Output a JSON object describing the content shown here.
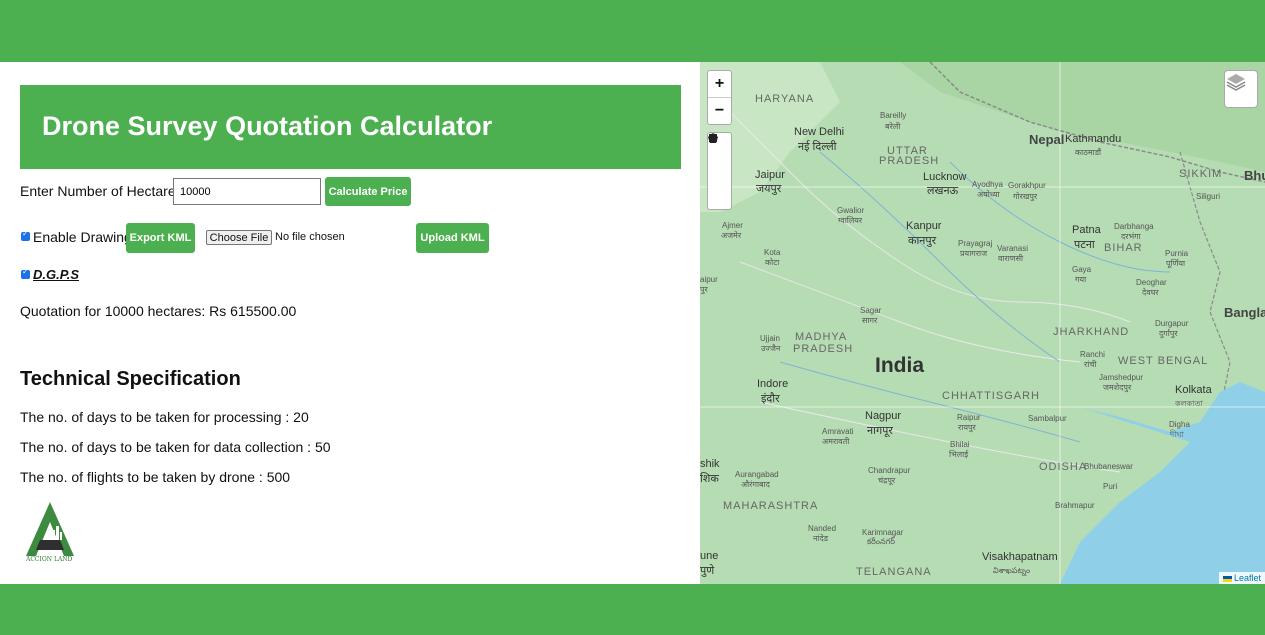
{
  "header": {
    "title": "Drone Survey Quotation Calculator"
  },
  "form": {
    "hectares_label": "Enter Number of Hectares:",
    "hectares_value": "10000",
    "calculate_label": "Calculate Price",
    "enable_drawing_label": "Enable Drawing",
    "export_kml_label": "Export KML",
    "choose_file_label": "Choose File",
    "file_status": "No file chosen",
    "upload_kml_label": "Upload KML",
    "dgps_label": "D.G.P.S"
  },
  "quotation": {
    "text": "Quotation for 10000 hectares: Rs 615500.00"
  },
  "tech": {
    "title": "Technical Specification",
    "processing": "The no. of days to be taken for processing : 20",
    "collection": "The no. of days to be taken for data collection : 50",
    "flights": "The no. of flights to be taken by drone : 500"
  },
  "logo": {
    "text": "ACCION LAND"
  },
  "map": {
    "zoom_in": "+",
    "zoom_out": "−",
    "attribution": "Leaflet",
    "labels": {
      "haryana": "HARYANA",
      "new_delhi": "New Delhi",
      "new_delhi_hi": "नई दिल्ली",
      "bareilly": "Bareilly",
      "bareilly_hi": "बरेली",
      "uttar": "UTTAR",
      "pradesh_up": "PRADESH",
      "nepal": "Nepal",
      "kathmandu": "Kathmandu",
      "kathmandu_ne": "काठमाडौं",
      "sikkim": "SIKKIM",
      "bhu": "Bhu",
      "siliguri": "Siliguri",
      "jaipur": "Jaipur",
      "jaipur_hi": "जयपुर",
      "lucknow": "Lucknow",
      "lucknow_hi": "लखनऊ",
      "ayodhya": "Ayodhya",
      "ayodhya_hi": "अयोध्या",
      "gorakhpur": "Gorakhpur",
      "gorakhpur_hi": "गोरखपुर",
      "gwalior": "Gwalior",
      "gwalior_hi": "ग्वालियर",
      "kanpur": "Kanpur",
      "kanpur_hi": "कानपुर",
      "patna": "Patna",
      "patna_hi": "पटना",
      "darbhanga": "Darbhanga",
      "darbhanga_hi": "दरभंगा",
      "ajmer": "Ajmer",
      "ajmer_hi": "अजमेर",
      "prayagraj": "Prayagraj",
      "prayagraj_hi": "प्रयागराज",
      "varanasi": "Varanasi",
      "varanasi_hi": "वाराणसी",
      "bihar": "BIHAR",
      "purnia": "Purnia",
      "purnia_hi": "पूर्णिया",
      "kota": "Kota",
      "kota_hi": "कोटा",
      "gaya": "Gaya",
      "gaya_hi": "गया",
      "deoghar": "Deoghar",
      "deoghar_hi": "देवघर",
      "udaipur": "aipur",
      "udaipur_hi": "पुर",
      "bangla": "Bangla",
      "sagar": "Sagar",
      "sagar_hi": "सागर",
      "jharkhand": "JHARKHAND",
      "durgapur": "Durgapur",
      "durgapur_hi": "दुर्गापुर",
      "ujjain": "Ujjain",
      "ujjain_hi": "उज्जैन",
      "madhya": "MADHYA",
      "pradesh_mp": "PRADESH",
      "ranchi": "Ranchi",
      "ranchi_hi": "रांची",
      "west_bengal": "WEST BENGAL",
      "india": "India",
      "jamshedpur": "Jamshedpur",
      "jamshedpur_hi": "जमशेदपुर",
      "indore": "Indore",
      "indore_hi": "इंदौर",
      "kolkata": "Kolkata",
      "kolkata_bn": "কলকাতা",
      "chhattisgarh": "CHHATTISGARH",
      "nagpur": "Nagpur",
      "nagpur_mr": "नागपूर",
      "raipur": "Raipur",
      "raipur_hi": "रायपुर",
      "sambalpur": "Sambalpur",
      "digha": "Digha",
      "digha_bn": "দীঘা",
      "amravati": "Amravati",
      "amravati_mr": "अमरावती",
      "bhilai": "Bhilai",
      "bhilai_hi": "भिलाई",
      "nashik": "shik",
      "nashik_mr": "शिक",
      "aurangabad": "Aurangabad",
      "aurangabad_mr": "औरंगाबाद",
      "chandrapur": "Chandrapur",
      "chandrapur_mr": "चंद्रपूर",
      "odisha": "ODISHA",
      "bhubaneswar": "Bhubaneswar",
      "puri": "Puri",
      "maharashtra": "MAHARASHTRA",
      "brahmapur": "Brahmapur",
      "nanded": "Nanded",
      "nanded_mr": "नांदेड",
      "karimnagar": "Karimnagar",
      "karimnagar_te": "కరీంనగర్",
      "pune": "une",
      "pune_mr": "पुणे",
      "visakhapatnam": "Visakhapatnam",
      "visakhapatnam_te": "విశాఖపట్నం",
      "telangana": "TELANGANA"
    }
  }
}
